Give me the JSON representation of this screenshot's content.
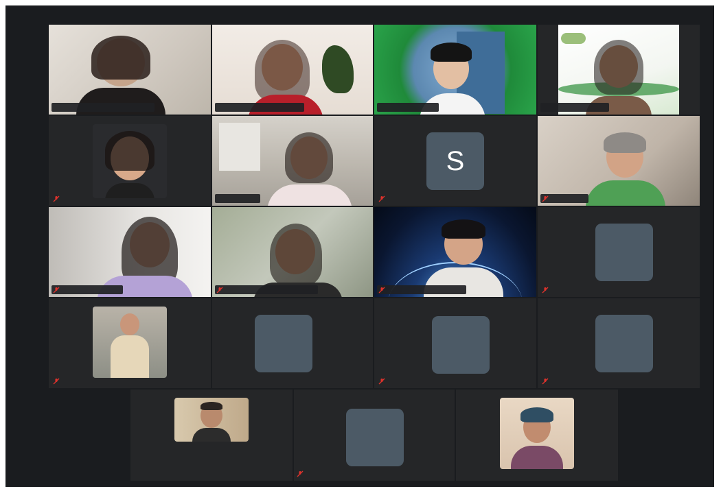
{
  "meeting": {
    "rows": [
      [
        {
          "id": "p1",
          "kind": "video",
          "bg": "#d8d3cc",
          "active": false,
          "muted": false
        },
        {
          "id": "p2",
          "kind": "video",
          "bg": "#e9e3de",
          "active": true,
          "muted": false
        },
        {
          "id": "p3",
          "kind": "video",
          "bg": "#2b8a3e",
          "active": false,
          "muted": false
        },
        {
          "id": "p4",
          "kind": "video",
          "bg": "#f2f2f2",
          "active": false,
          "muted": false
        }
      ],
      [
        {
          "id": "p5",
          "kind": "photo",
          "bg": "#2a2b2e",
          "active": false,
          "muted": true
        },
        {
          "id": "p6",
          "kind": "video",
          "bg": "#c7c4bd",
          "active": false,
          "muted": false
        },
        {
          "id": "p7",
          "kind": "avatar",
          "initial": "S",
          "active": false,
          "muted": true
        },
        {
          "id": "p8",
          "kind": "video",
          "bg": "#c9c1b8",
          "active": false,
          "muted": true
        }
      ],
      [
        {
          "id": "p9",
          "kind": "video",
          "bg": "#d9d6d2",
          "active": false,
          "muted": true
        },
        {
          "id": "p10",
          "kind": "video",
          "bg": "#a7b09b",
          "active": false,
          "muted": true
        },
        {
          "id": "p11",
          "kind": "video",
          "bg": "#0e1f40",
          "active": false,
          "muted": true
        },
        {
          "id": "p12",
          "kind": "avatar",
          "initial": "",
          "active": false,
          "muted": true
        }
      ],
      [
        {
          "id": "p13",
          "kind": "photo",
          "bg": "#2a2b2e",
          "active": false,
          "muted": true
        },
        {
          "id": "p14",
          "kind": "avatar",
          "initial": "",
          "active": false,
          "muted": false
        },
        {
          "id": "p15",
          "kind": "avatar",
          "initial": "",
          "active": false,
          "muted": true
        },
        {
          "id": "p16",
          "kind": "avatar",
          "initial": "",
          "active": false,
          "muted": true
        }
      ],
      [
        {
          "id": "p17",
          "kind": "photo",
          "bg": "#2a2b2e",
          "active": false,
          "muted": false
        },
        {
          "id": "p18",
          "kind": "avatar",
          "initial": "",
          "active": false,
          "muted": true
        },
        {
          "id": "p19",
          "kind": "photo",
          "bg": "#2a2b2e",
          "active": false,
          "muted": false
        }
      ]
    ],
    "colors": {
      "stage": "#1a1c1f",
      "tile": "#252628",
      "avatar": "#4c5a66",
      "active_border": "#2dbb4b",
      "muted_icon": "#e0322c"
    },
    "icons": {
      "muted": "mic-off-icon"
    }
  },
  "tiles": {
    "p7_initial": "S"
  }
}
